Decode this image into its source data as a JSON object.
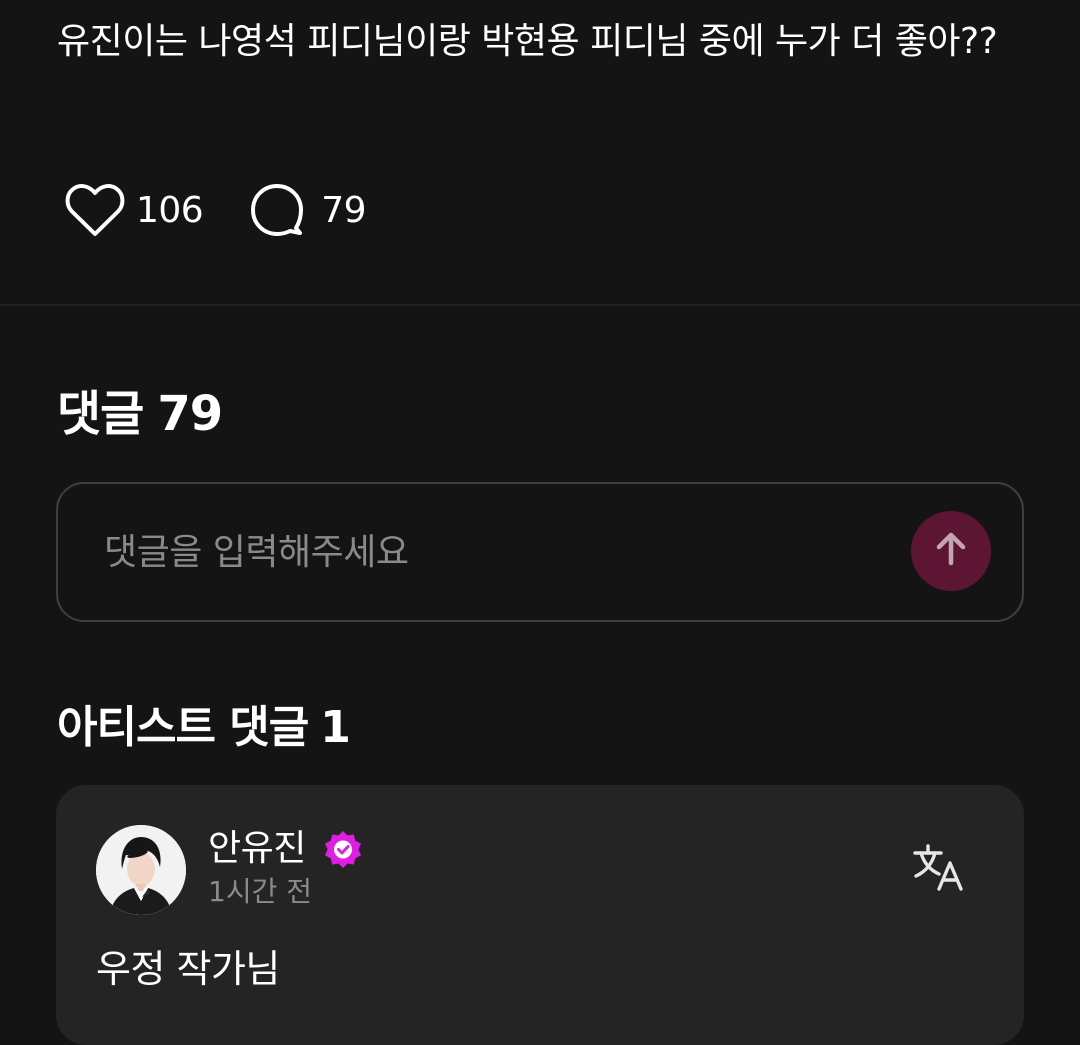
{
  "post": {
    "text": "유진이는 나영석 피디님이랑 박현용 피디님 중에 누가 더 좋아??",
    "likes": "106",
    "comments": "79"
  },
  "comments_section": {
    "heading": "댓글",
    "count": "79",
    "input_placeholder": "댓글을 입력해주세요"
  },
  "artist_comments": {
    "heading": "아티스트 댓글",
    "count": "1",
    "items": [
      {
        "author": "안유진",
        "time": "1시간 전",
        "text": "우정 작가님"
      }
    ]
  },
  "icons": {
    "like": "heart-outline-icon",
    "comment": "speech-bubble-icon",
    "send": "arrow-up-icon",
    "verified": "verified-badge-icon",
    "translate": "translate-icon"
  },
  "colors": {
    "background": "#141414",
    "card": "#242424",
    "send_button": "#5c1634",
    "verified": "#e01ee3",
    "muted_text": "#8a8a8a"
  }
}
